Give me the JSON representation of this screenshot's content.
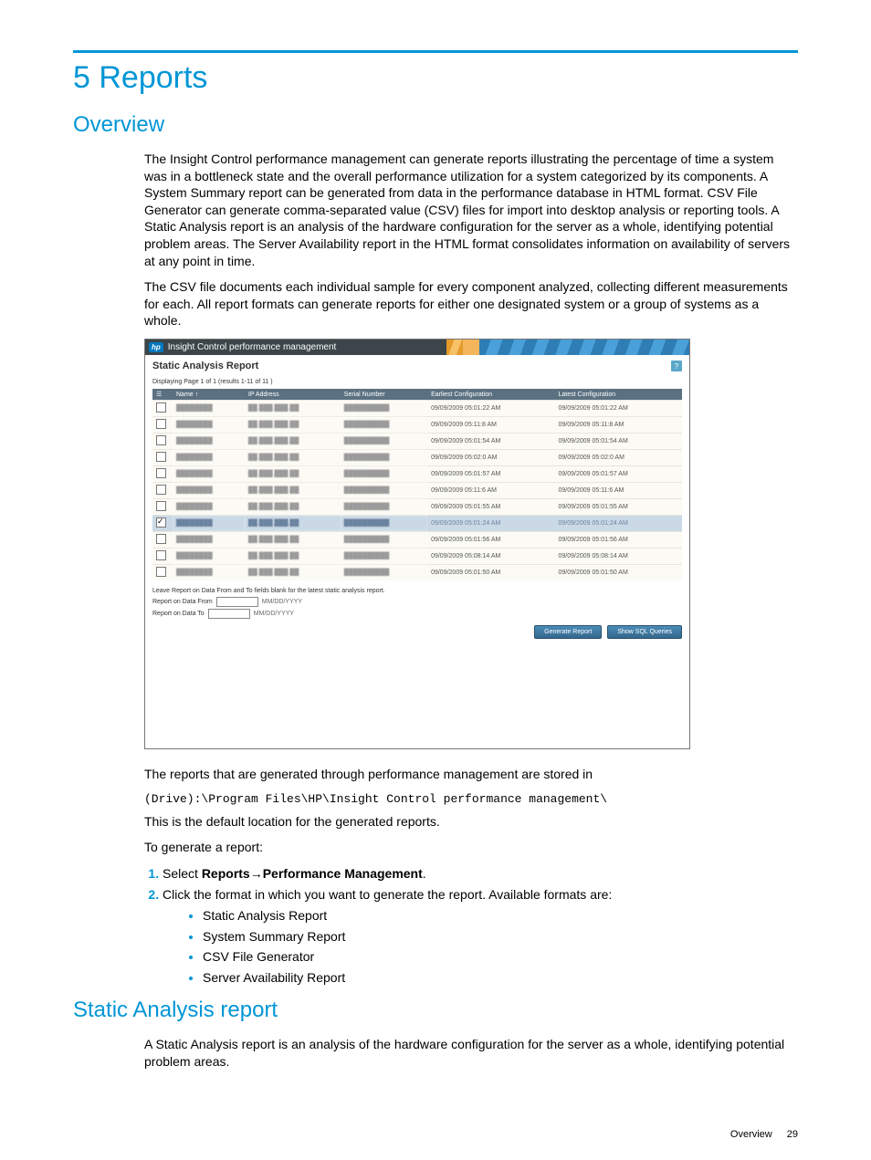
{
  "chapter": {
    "title": "5 Reports"
  },
  "overview": {
    "heading": "Overview",
    "para1": "The Insight Control performance management can generate reports illustrating the percentage of time a system was in a bottleneck state and the overall performance utilization for a system categorized by its components. A System Summary report can be generated from data in the performance database in HTML format. CSV File Generator can generate comma-separated value (CSV) files for import into desktop analysis or reporting tools. A Static Analysis report is an analysis of the hardware configuration for the server as a whole, identifying potential problem areas. The Server Availability report in the HTML format consolidates information on availability of servers at any point in time.",
    "para2": "The CSV file documents each individual sample for every component analyzed, collecting different measurements for each. All report formats can generate reports for either one designated system or a group of systems as a whole."
  },
  "screenshot": {
    "app_title": "Insight Control performance management",
    "subtitle": "Static Analysis Report",
    "help_glyph": "?",
    "paging": "Displaying Page 1 of 1 (results 1-11 of 11 )",
    "columns": {
      "name": "Name",
      "ip": "IP Address",
      "serial": "Serial Number",
      "earliest": "Earliest Configuration",
      "latest": "Latest Configuration"
    },
    "rows": [
      {
        "sel": false,
        "earliest": "09/09/2009 05:01:22 AM",
        "latest": "09/09/2009 05:01:22 AM"
      },
      {
        "sel": false,
        "earliest": "09/09/2009 05:11:8 AM",
        "latest": "09/09/2009 05:11:8 AM"
      },
      {
        "sel": false,
        "earliest": "09/09/2009 05:01:54 AM",
        "latest": "09/09/2009 05:01:54 AM"
      },
      {
        "sel": false,
        "earliest": "09/09/2009 05:02:0 AM",
        "latest": "09/09/2009 05:02:0 AM"
      },
      {
        "sel": false,
        "earliest": "09/09/2009 05:01:57 AM",
        "latest": "09/09/2009 05:01:57 AM"
      },
      {
        "sel": false,
        "earliest": "09/09/2009 05:11:6 AM",
        "latest": "09/09/2009 05:11:6 AM"
      },
      {
        "sel": false,
        "earliest": "09/09/2009 05:01:55 AM",
        "latest": "09/09/2009 05:01:55 AM"
      },
      {
        "sel": true,
        "earliest": "09/09/2009 05:01:24 AM",
        "latest": "09/09/2009 05:01:24 AM"
      },
      {
        "sel": false,
        "earliest": "09/09/2009 05:01:56 AM",
        "latest": "09/09/2009 05:01:56 AM"
      },
      {
        "sel": false,
        "earliest": "09/09/2009 05:08:14 AM",
        "latest": "09/09/2009 05:08:14 AM"
      },
      {
        "sel": false,
        "earliest": "09/09/2009 05:01:50 AM",
        "latest": "09/09/2009 05:01:50 AM"
      }
    ],
    "note": "Leave Report on Data From and To fields blank for the latest static analysis report.",
    "from_label": "Report on Data From",
    "to_label": "Report on Data To",
    "date_hint": "MM/DD/YYYY",
    "btn_generate": "Generate Report",
    "btn_sql": "Show SQL Queries"
  },
  "after": {
    "stored_in": "The reports that are generated through performance management are stored in",
    "path": "(Drive):\\Program Files\\HP\\Insight Control performance management\\",
    "default_loc": "This is the default location for the generated reports.",
    "to_generate": "To generate a report:",
    "step1_pre": "Select ",
    "step1_b1": "Reports",
    "step1_arrow": "→",
    "step1_b2": "Performance Management",
    "step1_post": ".",
    "step2": "Click the format in which you want to generate the report. Available formats are:",
    "formats": [
      "Static Analysis Report",
      "System Summary Report",
      "CSV File Generator",
      "Server Availability Report"
    ]
  },
  "static_section": {
    "heading": "Static Analysis report",
    "para": "A Static Analysis report is an analysis of the hardware configuration for the server as a whole, identifying potential problem areas."
  },
  "footer": {
    "section": "Overview",
    "page": "29"
  }
}
